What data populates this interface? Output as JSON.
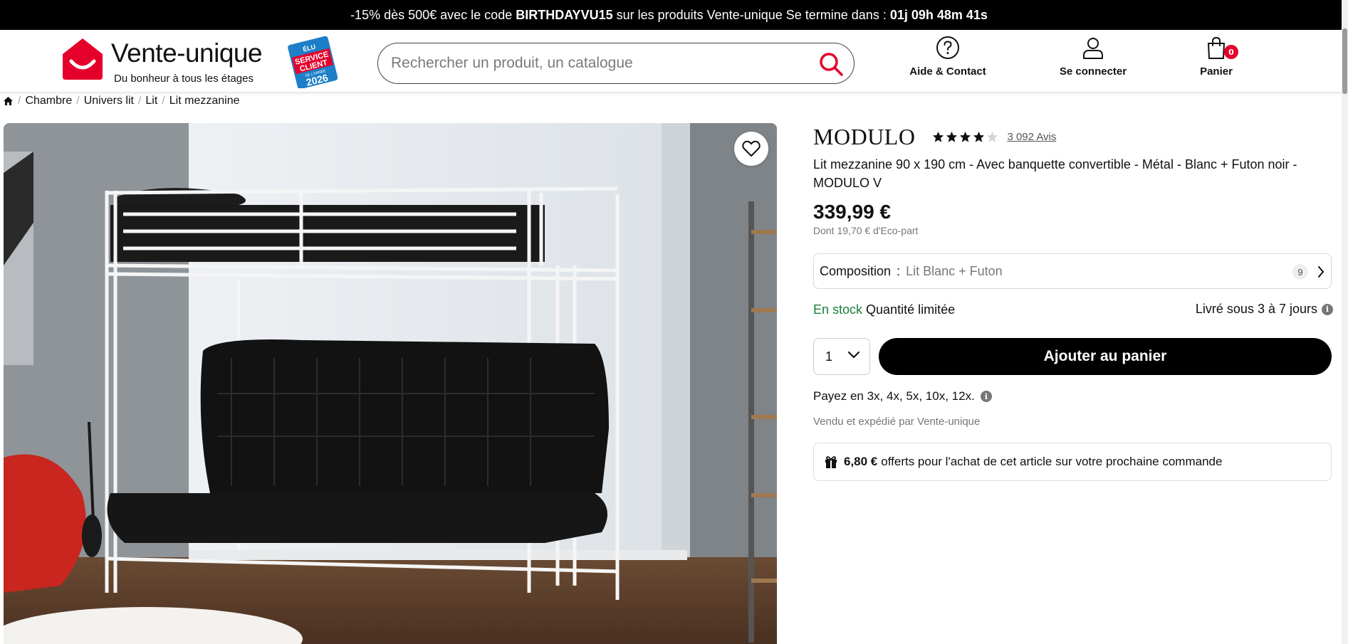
{
  "promo": {
    "pre": "-15% dès 500€ avec le code",
    "code": "BIRTHDAYVU15",
    "mid": "sur les produits Vente-unique Se termine dans :",
    "countdown": "01j 09h 48m 41s"
  },
  "logo": {
    "name": "Vente-unique",
    "tagline": "Du bonheur à tous les étages",
    "badge_line1": "ÉLU",
    "badge_line2": "SERVICE",
    "badge_line3": "CLIENT",
    "badge_line4": "DE L'ANNÉE",
    "badge_year": "2026"
  },
  "search": {
    "placeholder": "Rechercher un produit, un catalogue"
  },
  "nav": {
    "help": "Aide & Contact",
    "login": "Se connecter",
    "cart": "Panier",
    "cart_count": "0"
  },
  "breadcrumb": [
    "Chambre",
    "Univers lit",
    "Lit",
    "Lit mezzanine"
  ],
  "product": {
    "brand": "MODULO",
    "rating": 4,
    "rating_max": 5,
    "reviews": "3 092 Avis",
    "title": "Lit mezzanine 90 x 190 cm - Avec banquette convertible - Métal - Blanc + Futon noir - MODULO V",
    "price": "339,99 €",
    "eco_part": "Dont 19,70 € d'Eco-part",
    "composition_label": "Composition",
    "composition_colon": ":",
    "composition_value": "Lit Blanc + Futon",
    "composition_count": "9",
    "stock": "En stock",
    "stock_note": "Quantité limitée",
    "delivery": "Livré sous 3 à 7 jours",
    "quantity": "1",
    "add_to_cart": "Ajouter au panier",
    "payment": "Payez en 3x, 4x, 5x, 10x, 12x.",
    "seller": "Vendu et expédié par Vente-unique",
    "gift_amount": "6,80 €",
    "gift_text": "offerts pour l'achat de cet article sur votre prochaine commande"
  },
  "colors": {
    "accent_red": "#e4002b",
    "stock_green": "#1a7f3c",
    "button_black": "#000000"
  }
}
